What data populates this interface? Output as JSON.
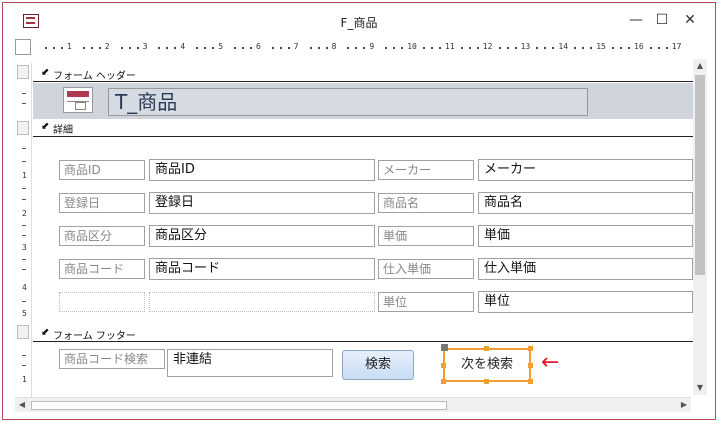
{
  "window": {
    "title": "F_商品",
    "minimize_glyph": "—",
    "maximize_glyph": "☐",
    "close_glyph": "✕"
  },
  "ruler": {
    "numbers": [
      "1",
      "2",
      "3",
      "4",
      "5",
      "6",
      "7",
      "8",
      "9",
      "10",
      "11",
      "12",
      "13",
      "14",
      "15",
      "16",
      "17"
    ],
    "vertical_numbers": [
      "1",
      "2",
      "3",
      "4",
      "5",
      "1"
    ]
  },
  "sections": {
    "form_header": "フォーム ヘッダー",
    "detail": "詳細",
    "form_footer": "フォーム フッター",
    "arrow_glyph": "⬋"
  },
  "header": {
    "title": "T_商品"
  },
  "detail": {
    "left": [
      {
        "label": "商品ID",
        "value": "商品ID"
      },
      {
        "label": "登録日",
        "value": "登録日"
      },
      {
        "label": "商品区分",
        "value": "商品区分"
      },
      {
        "label": "商品コード",
        "value": "商品コード"
      }
    ],
    "right": [
      {
        "label": "メーカー",
        "value": "メーカー"
      },
      {
        "label": "商品名",
        "value": "商品名"
      },
      {
        "label": "単価",
        "value": "単価"
      },
      {
        "label": "仕入単価",
        "value": "仕入単価"
      },
      {
        "label": "単位",
        "value": "単位"
      }
    ]
  },
  "footer": {
    "search_label": "商品コード検索",
    "search_value": "非連結",
    "search_button": "検索",
    "next_button": "次を検索",
    "arrow_glyph": "←"
  },
  "colors": {
    "accent": "#f0a030",
    "arrow": "#e8192c",
    "header_band": "#d0d4dc"
  }
}
